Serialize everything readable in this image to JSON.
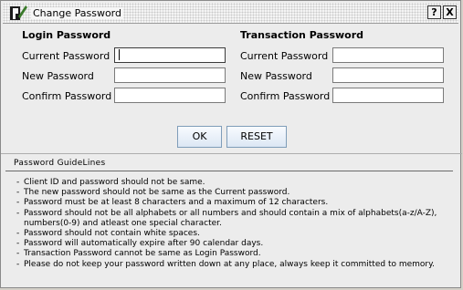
{
  "window": {
    "title": "Change Password",
    "help_label": "?",
    "close_label": "X"
  },
  "login": {
    "heading": "Login Password",
    "current_label": "Current Password",
    "new_label": "New Password",
    "confirm_label": "Confirm Password",
    "current_value": "",
    "new_value": "",
    "confirm_value": ""
  },
  "transaction": {
    "heading": "Transaction Password",
    "current_label": "Current Password",
    "new_label": "New Password",
    "confirm_label": "Confirm Password",
    "current_value": "",
    "new_value": "",
    "confirm_value": ""
  },
  "buttons": {
    "ok": "OK",
    "reset": "RESET"
  },
  "guidelines": {
    "title": "Password GuideLines",
    "items": [
      "Client ID and password should not be same.",
      "The new password should not be same as the Current password.",
      "Password must be at least 8 characters and a maximum of 12 characters.",
      "Password should not be all alphabets or all numbers and should contain a mix of alphabets(a-z/A-Z),",
      "numbers(0-9) and atleast one special character.",
      "Password should not contain white spaces.",
      "Password will automatically expire after 90 calendar days.",
      "Transaction Password cannot be same as Login Password.",
      "Please do not keep your password written down at any place, always keep it committed to memory."
    ]
  },
  "colors": {
    "window_bg": "#ececec",
    "button_border": "#7f9db9",
    "icon_green": "#3a7a2a"
  },
  "icons": {
    "app": "pencil-p-icon"
  }
}
